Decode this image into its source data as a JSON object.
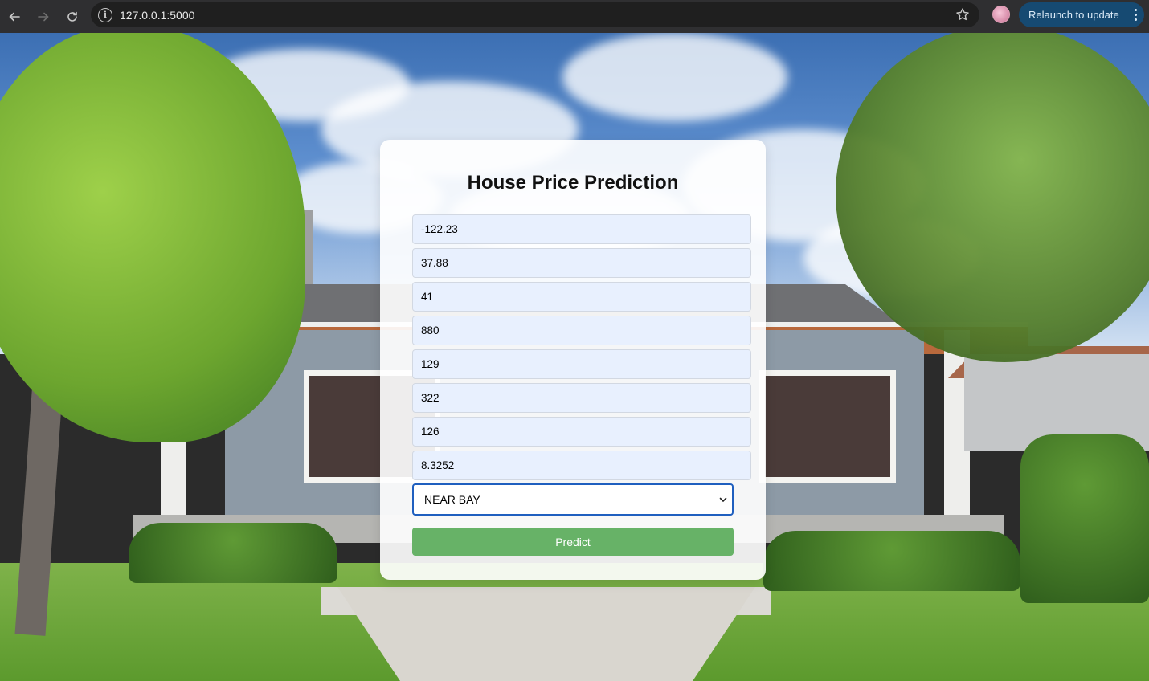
{
  "browser": {
    "url": "127.0.0.1:5000",
    "relaunch_label": "Relaunch to update"
  },
  "form": {
    "title": "House Price Prediction",
    "fields": [
      {
        "name": "longitude",
        "value": "-122.23"
      },
      {
        "name": "latitude",
        "value": "37.88"
      },
      {
        "name": "housing-median-age",
        "value": "41"
      },
      {
        "name": "total-rooms",
        "value": "880"
      },
      {
        "name": "total-bedrooms",
        "value": "129"
      },
      {
        "name": "population",
        "value": "322"
      },
      {
        "name": "households",
        "value": "126"
      },
      {
        "name": "median-income",
        "value": "8.3252"
      }
    ],
    "ocean_proximity": "NEAR BAY",
    "submit_label": "Predict"
  }
}
